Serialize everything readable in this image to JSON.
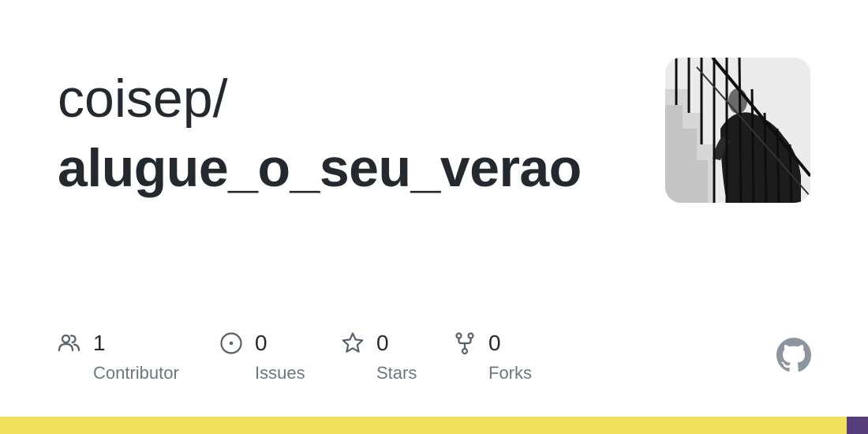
{
  "repo": {
    "owner": "coisep/",
    "name": "alugue_o_seu_verao"
  },
  "stats": [
    {
      "icon": "people-icon",
      "value": "1",
      "label": "Contributor"
    },
    {
      "icon": "issue-circle-icon",
      "value": "0",
      "label": "Issues"
    },
    {
      "icon": "star-icon",
      "value": "0",
      "label": "Stars"
    },
    {
      "icon": "fork-icon",
      "value": "0",
      "label": "Forks"
    }
  ],
  "brand_icon": "github-mark-icon",
  "language_bar": [
    {
      "color": "#f1e05a",
      "fraction": 0.975
    },
    {
      "color": "#563d7c",
      "fraction": 0.025
    }
  ],
  "colors": {
    "text_primary": "#24292f",
    "text_secondary": "#6e7781",
    "icon_gray": "#57606a",
    "github_mark": "#8c959f"
  }
}
